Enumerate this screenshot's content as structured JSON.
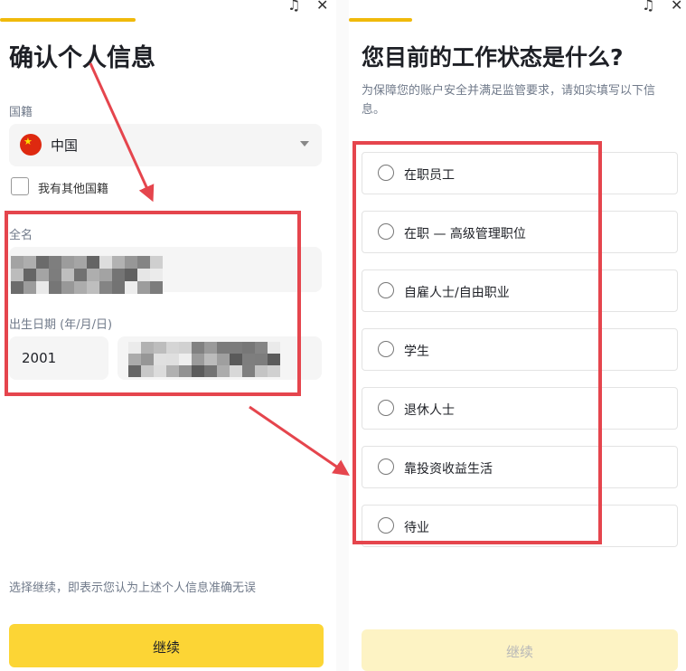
{
  "colors": {
    "accent": "#f0b90b",
    "annotation": "#e5454d",
    "field_bg": "#f5f5f5"
  },
  "icons": {
    "top_icon_1": "headset-icon",
    "top_icon_2": "close-icon"
  },
  "left": {
    "top_icon_symbol": "♫",
    "close_symbol": "✕",
    "title": "确认个人信息",
    "nationality_label": "国籍",
    "nationality_value": "中国",
    "other_nationality_label": "我有其他国籍",
    "fullname_label": "全名",
    "dob_label": "出生日期 (年/月/日)",
    "dob_year": "2001",
    "disclaimer": "选择继续，即表示您认为上述个人信息准确无误",
    "continue_label": "继续"
  },
  "right": {
    "top_icon_symbol": "♫",
    "close_symbol": "✕",
    "title": "您目前的工作状态是什么?",
    "subtitle": "为保障您的账户安全并满足监管要求，请如实填写以下信息。",
    "options": [
      "在职员工",
      "在职 — 高级管理职位",
      "自雇人士/自由职业",
      "学生",
      "退休人士",
      "靠投资收益生活",
      "待业"
    ],
    "continue_label": "继续"
  }
}
